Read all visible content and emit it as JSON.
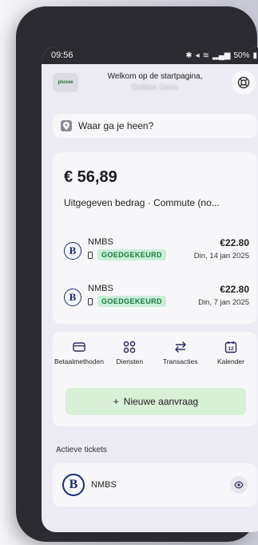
{
  "status_bar": {
    "time": "09:56",
    "icons": [
      "bluetooth-icon",
      "mute-icon",
      "wifi-icon",
      "signal-icon"
    ],
    "battery": "50%"
  },
  "header": {
    "logo_text": "plusee",
    "welcome": "Welkom op de startpagina,",
    "user_name": "Debbie Gens",
    "help_icon": "lifebuoy-icon"
  },
  "search": {
    "icon": "location-pin-icon",
    "placeholder": "Waar ga je heen?"
  },
  "spending": {
    "amount": "€ 56,89",
    "label": "Uitgegeven bedrag · Commute (no..."
  },
  "transactions": [
    {
      "operator": "NMBS",
      "logo_letter": "B",
      "status": "GOEDGEKEURD",
      "price": "€22.80",
      "date": "Din, 14 jan 2025"
    },
    {
      "operator": "NMBS",
      "logo_letter": "B",
      "status": "GOEDGEKEURD",
      "price": "€22.80",
      "date": "Din, 7 jan 2025"
    }
  ],
  "actions": [
    {
      "label": "Betaalmethoden",
      "icon": "card-icon"
    },
    {
      "label": "Diensten",
      "icon": "grid-icon"
    },
    {
      "label": "Transacties",
      "icon": "swap-arrows-icon"
    },
    {
      "label": "Kalender",
      "icon": "calendar-icon",
      "calendar_day": "12"
    }
  ],
  "new_request": {
    "plus": "+",
    "label": "Nieuwe aanvraag"
  },
  "active_tickets": {
    "title": "Actieve tickets",
    "items": [
      {
        "operator": "NMBS",
        "logo_letter": "B",
        "icon": "eye-icon"
      }
    ]
  },
  "colors": {
    "badge_bg": "#c8efd8",
    "badge_text": "#1a7a3e",
    "new_button_bg": "#d8f0d6",
    "brand_blue": "#1b2a7a",
    "screen_bg": "#eceaf2"
  }
}
